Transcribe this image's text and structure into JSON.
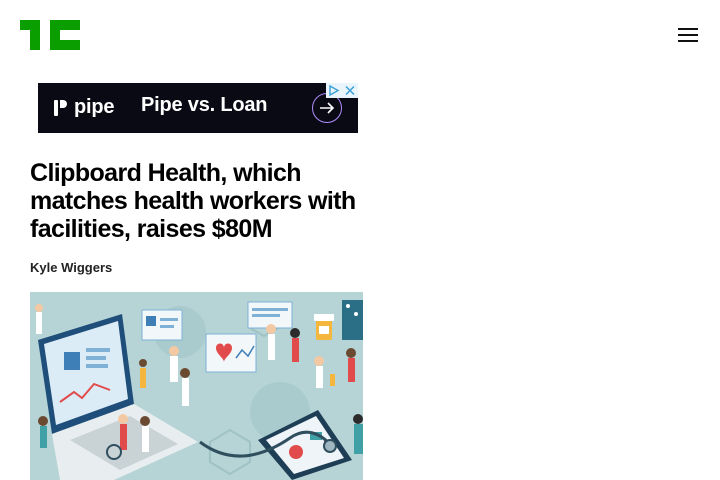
{
  "header": {
    "logo_icon": "techcrunch-logo",
    "logo_color": "#0a9e01",
    "menu_icon": "hamburger-menu-icon"
  },
  "ad": {
    "brand": "pipe",
    "headline": "Pipe vs. Loan",
    "background": "#0a0a14",
    "cta_icon": "arrow-right-icon",
    "choices_icon": "adchoices-icon",
    "close_icon": "close-icon"
  },
  "article": {
    "title": "Clipboard Health, which matches health workers with facilities, raises $80M",
    "author": "Kyle Wiggers",
    "image_icon": "healthcare-illustration"
  }
}
